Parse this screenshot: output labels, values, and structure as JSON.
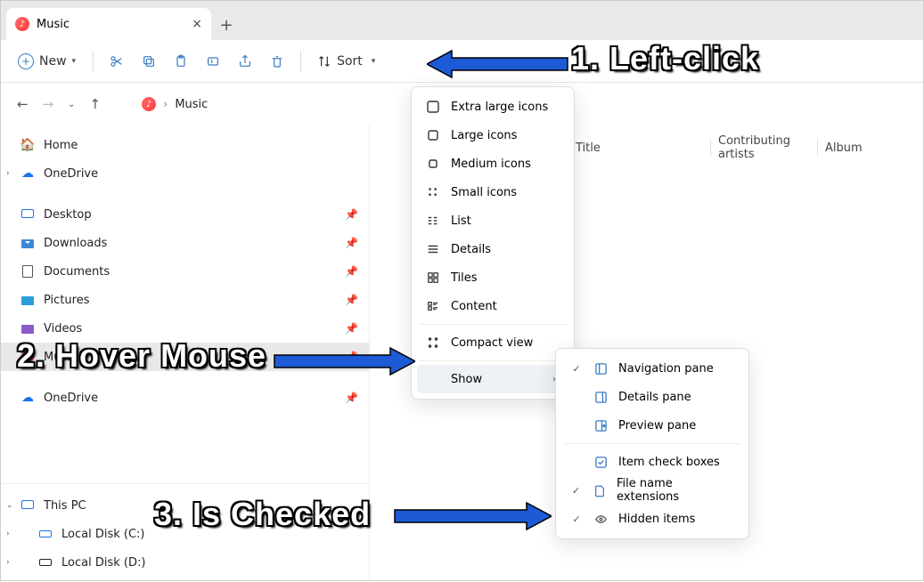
{
  "tab": {
    "title": "Music",
    "close": "×",
    "new": "+"
  },
  "toolbar": {
    "new_label": "New",
    "sort_label": "Sort"
  },
  "breadcrumb": {
    "sep": "›",
    "current": "Music"
  },
  "columns": {
    "c1": "Title",
    "c2": "Contributing artists",
    "c3": "Album"
  },
  "sidebar": {
    "home": "Home",
    "onedrive": "OneDrive",
    "desktop": "Desktop",
    "downloads": "Downloads",
    "documents": "Documents",
    "pictures": "Pictures",
    "videos": "Videos",
    "music": "Music",
    "onedrive2": "OneDrive",
    "thispc": "This PC",
    "localc": "Local Disk (C:)",
    "locald": "Local Disk (D:)"
  },
  "menu_view": {
    "xl": "Extra large icons",
    "lg": "Large icons",
    "md": "Medium icons",
    "sm": "Small icons",
    "list": "List",
    "details": "Details",
    "tiles": "Tiles",
    "content": "Content",
    "compact": "Compact view",
    "show": "Show"
  },
  "menu_show": {
    "nav": "Navigation pane",
    "det": "Details pane",
    "prev": "Preview pane",
    "chk": "Item check boxes",
    "ext": "File name extensions",
    "hid": "Hidden items"
  },
  "annot": {
    "a1": "1. Left-click",
    "a2": "2. Hover Mouse",
    "a3": "3. Is Checked"
  }
}
